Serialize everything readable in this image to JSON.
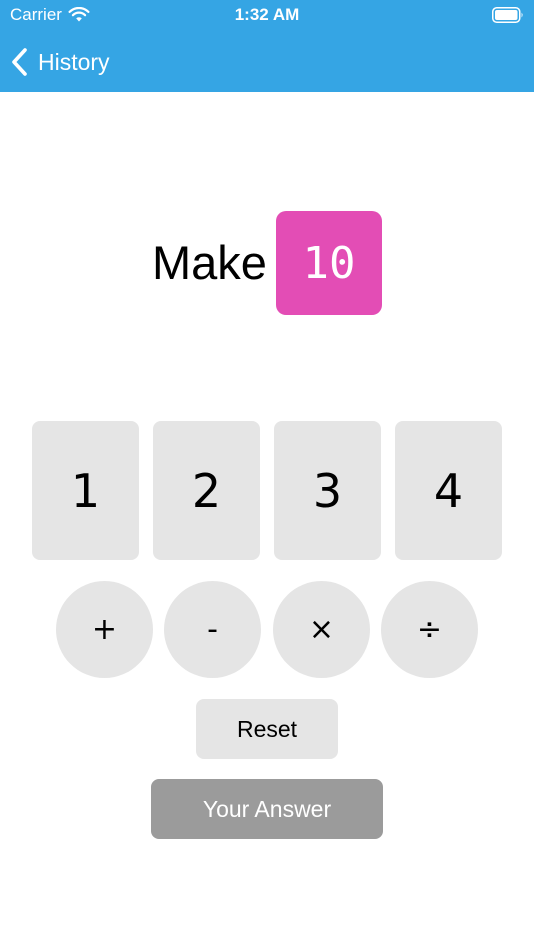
{
  "status_bar": {
    "carrier": "Carrier",
    "time": "1:32 AM",
    "wifi_icon": "wifi-icon",
    "battery_icon": "battery-icon"
  },
  "nav_bar": {
    "back_label": "History",
    "back_icon": "chevron-left-icon"
  },
  "target": {
    "make_label": "Make",
    "value": "10"
  },
  "numbers": [
    "1",
    "2",
    "3",
    "4"
  ],
  "operators": [
    "+",
    "-",
    "×",
    "÷"
  ],
  "actions": {
    "reset_label": "Reset",
    "answer_label": "Your Answer"
  },
  "colors": {
    "nav_background": "#35a5e4",
    "target_background": "#e34db5",
    "tile_background": "#e5e5e5",
    "answer_background": "#9b9b9b"
  }
}
